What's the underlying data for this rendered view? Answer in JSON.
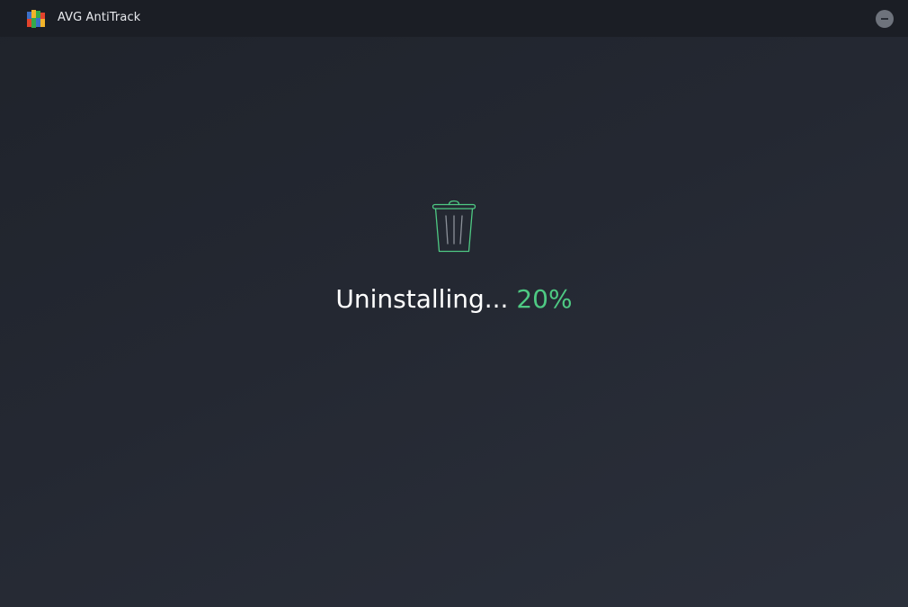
{
  "window": {
    "title": "AVG AntiTrack",
    "logo_icon": "avg-logo-icon",
    "minimize_icon": "minimize-icon"
  },
  "main": {
    "icon": "trash-icon",
    "status_label": "Uninstalling...",
    "progress_text": "20%",
    "progress_value": 20
  },
  "colors": {
    "accent": "#4ec983",
    "background": "#252932",
    "titlebar": "#1b1e25"
  }
}
